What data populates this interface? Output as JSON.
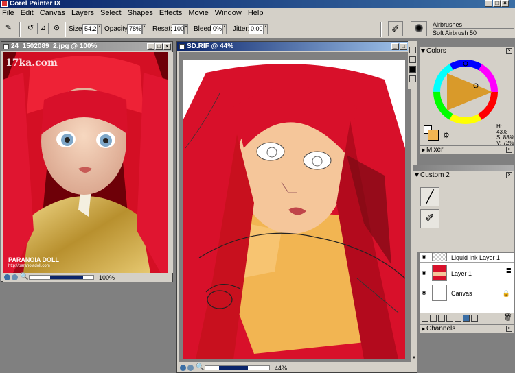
{
  "app": {
    "title": "Corel Painter IX"
  },
  "menu": [
    "File",
    "Edit",
    "Canvas",
    "Layers",
    "Select",
    "Shapes",
    "Effects",
    "Movie",
    "Window",
    "Help"
  ],
  "propbar": {
    "size_label": "Size:",
    "size_value": "54.2",
    "opacity_label": "Opacity:",
    "opacity_value": "78%",
    "resat_label": "Resat:",
    "resat_value": "100",
    "bleed_label": "Bleed:",
    "bleed_value": "0%",
    "jitter_label": "Jitter:",
    "jitter_value": "0.00",
    "brush_category": "Airbrushes",
    "brush_variant": "Soft Airbrush 50"
  },
  "doc1": {
    "title": "24_1502089_2.jpg @ 100%",
    "watermark_top": "17ka.com",
    "watermark_bottom": "PARANOIA DOLL",
    "watermark_url": "http://paranoiadoll.com",
    "zoom": "100%"
  },
  "doc2": {
    "title": "SD.RIF @ 44%",
    "zoom": "44%"
  },
  "colors_panel": {
    "title": "Colors",
    "h": "H: 43%",
    "s": "S: 88%",
    "v": "V: 72%"
  },
  "mixer_panel": {
    "title": "Mixer"
  },
  "custom_panel": {
    "title": "Custom 2"
  },
  "layers": [
    {
      "name": "Liquid Ink Layer 1"
    },
    {
      "name": "Layer 1"
    },
    {
      "name": "Canvas"
    }
  ],
  "channels_panel": {
    "title": "Channels"
  },
  "accent": "#0a246a",
  "hair_color": "#d8102a"
}
